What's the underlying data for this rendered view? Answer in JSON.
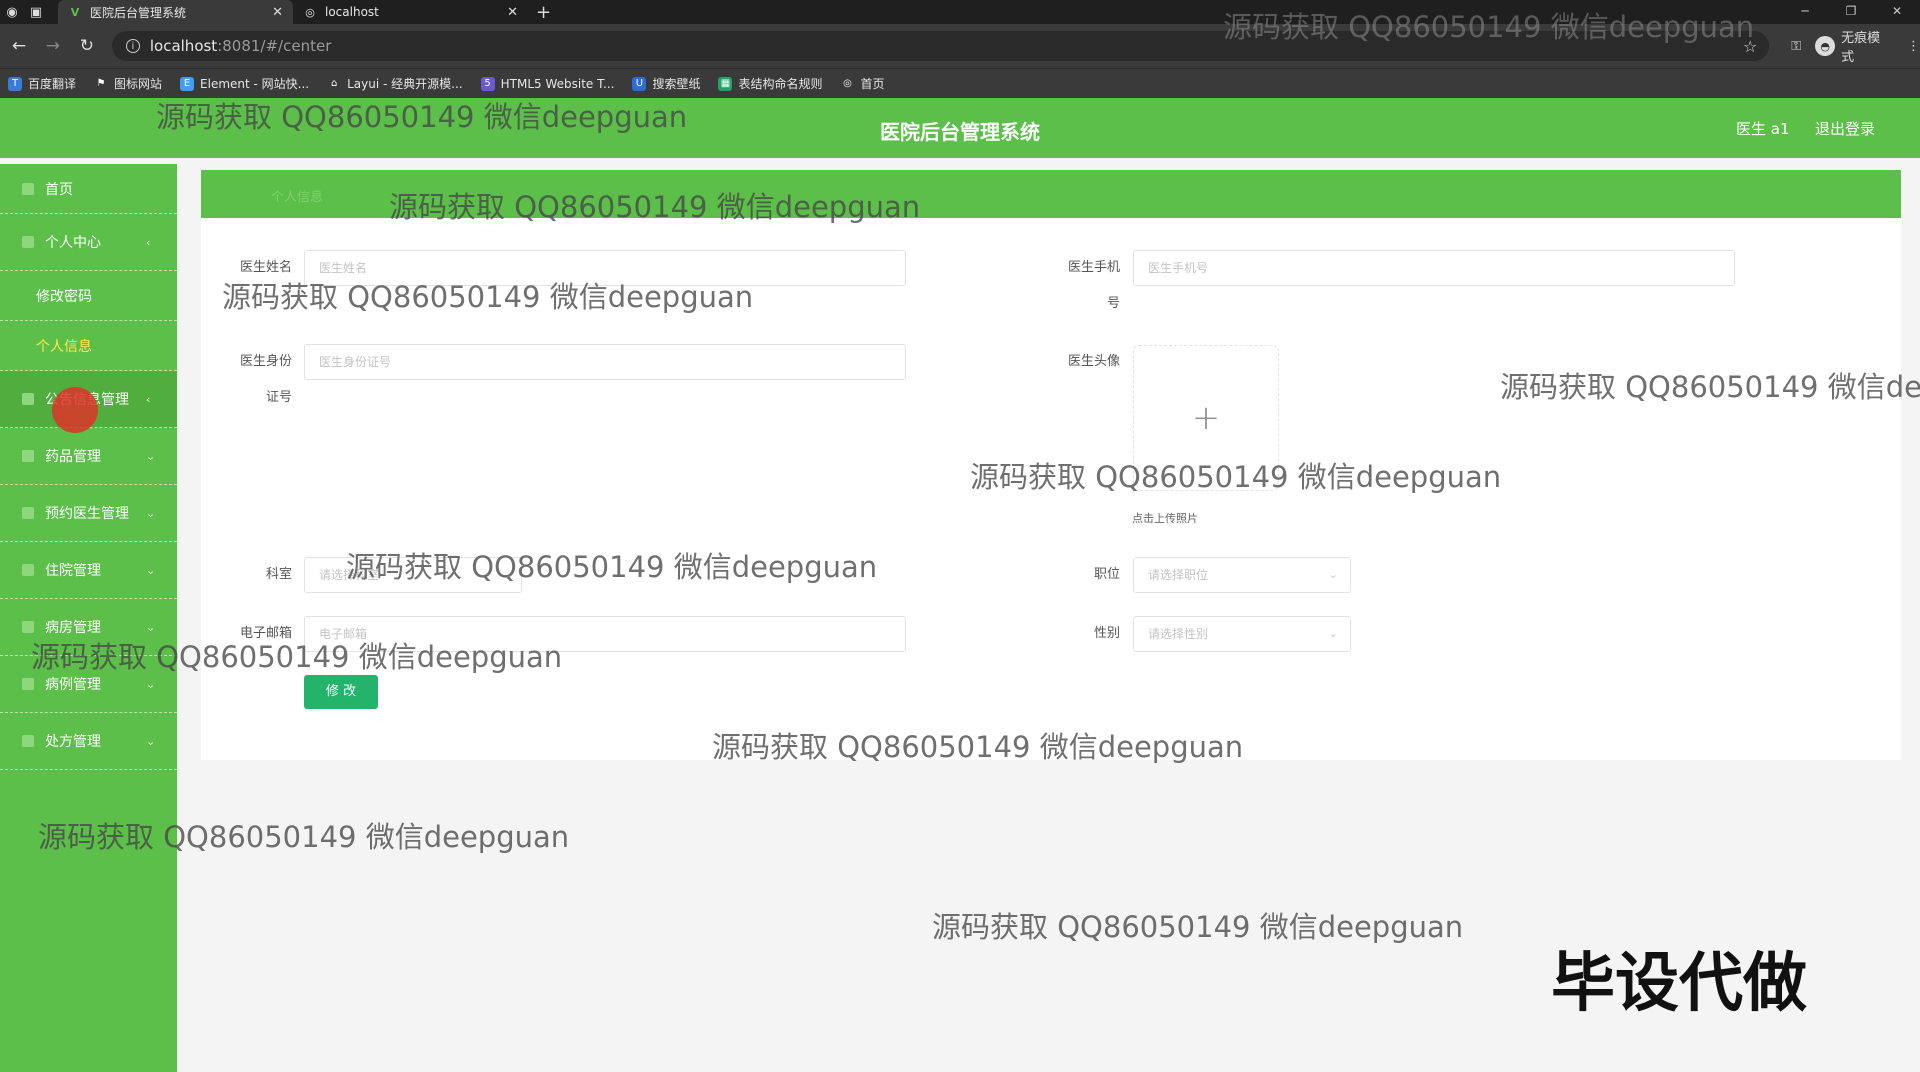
{
  "browser": {
    "tabs": [
      {
        "label": "医院后台管理系统",
        "active": true
      },
      {
        "label": "localhost",
        "active": false
      }
    ],
    "url_host": "localhost",
    "url_rest": ":8081/#/center",
    "incognito_label": "无痕模式",
    "bookmarks": [
      "百度翻译",
      "图标网站",
      "Element - 网站快...",
      "Layui - 经典开源模...",
      "HTML5 Website T...",
      "搜索壁纸",
      "表结构命名规则",
      "首页"
    ]
  },
  "header": {
    "title": "医院后台管理系统",
    "user": "医生 a1",
    "logout": "退出登录"
  },
  "sidebar": {
    "items": [
      {
        "label": "首页"
      },
      {
        "label": "个人中心",
        "arrow": "‹"
      },
      {
        "label": "公告信息管理",
        "arrow": "‹"
      },
      {
        "label": "药品管理",
        "arrow": "⌄"
      },
      {
        "label": "预约医生管理",
        "arrow": "⌄"
      },
      {
        "label": "住院管理",
        "arrow": "⌄"
      },
      {
        "label": "病房管理",
        "arrow": "⌄"
      },
      {
        "label": "病例管理",
        "arrow": "⌄"
      },
      {
        "label": "处方管理",
        "arrow": "⌄"
      }
    ],
    "sub_items": [
      {
        "label": "修改密码"
      },
      {
        "label": "个人信息"
      }
    ]
  },
  "banner": {
    "text": "个人信息"
  },
  "form": {
    "doctor_name": {
      "label": "医生姓名",
      "placeholder": "医生姓名"
    },
    "doctor_phone": {
      "label1": "医生手机",
      "label2": "号",
      "placeholder": "医生手机号"
    },
    "doctor_id": {
      "label1": "医生身份",
      "label2": "证号",
      "placeholder": "医生身份证号"
    },
    "doctor_avatar": {
      "label": "医生头像",
      "tip": "点击上传照片"
    },
    "department": {
      "label": "科室",
      "placeholder": "请选择科室"
    },
    "position": {
      "label": "职位",
      "placeholder": "请选择职位"
    },
    "email": {
      "label": "电子邮箱",
      "placeholder": "电子邮箱"
    },
    "gender": {
      "label": "性别",
      "placeholder": "请选择性别"
    },
    "submit": "修 改"
  },
  "watermarks": {
    "text": "源码获取 QQ86050149 微信deepguan",
    "cut_text": "源码获取 QQ86050149 微信de",
    "stamp": "毕设代做"
  },
  "colors": {
    "primary_green": "#5cbf4a",
    "button_green": "#23b36a",
    "active_submenu": "#ffe94a"
  }
}
